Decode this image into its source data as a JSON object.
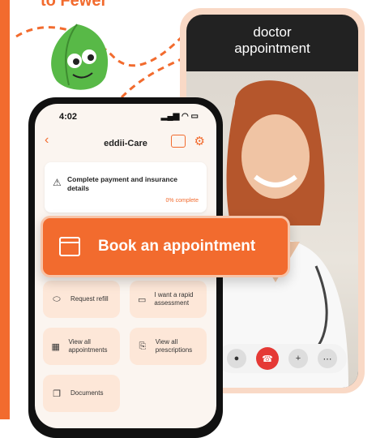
{
  "headline_fragment": "to Fewer",
  "video_call": {
    "title_line1": "doctor",
    "title_line2": "appointment",
    "controls": [
      "mute-icon",
      "end-call-icon",
      "add-person-icon",
      "more-icon"
    ]
  },
  "phone": {
    "status_time": "4:02",
    "app_title": "eddii-Care",
    "task": {
      "title": "Complete payment and insurance details",
      "progress": "0% complete"
    },
    "tiles": [
      {
        "icon": "pill-icon",
        "label": "Request refill"
      },
      {
        "icon": "chat-icon",
        "label": "I want a rapid assessment"
      },
      {
        "icon": "calendar-icon",
        "label": "View all appointments"
      },
      {
        "icon": "prescription-icon",
        "label": "View all prescriptions"
      },
      {
        "icon": "documents-icon",
        "label": "Documents"
      }
    ]
  },
  "book_banner": {
    "label": "Book an appointment"
  },
  "colors": {
    "accent": "#f26b2e",
    "tile_bg": "#fde7d8",
    "end_call": "#e53935"
  }
}
